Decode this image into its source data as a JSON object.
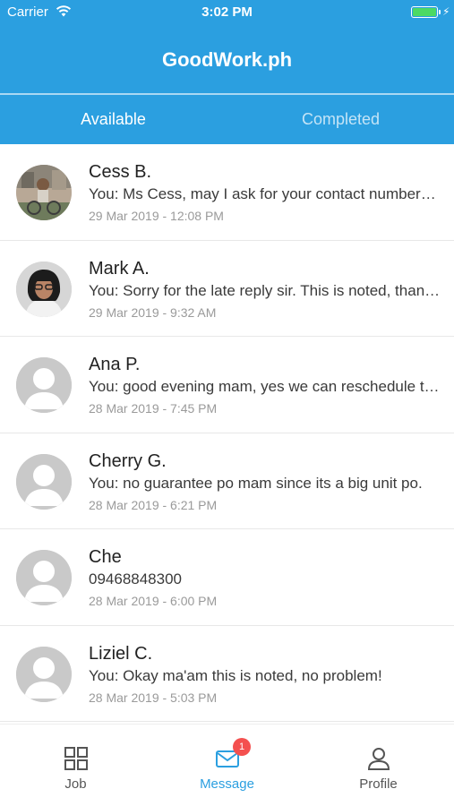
{
  "status_bar": {
    "carrier": "Carrier",
    "time": "3:02 PM"
  },
  "header": {
    "title": "GoodWork.ph"
  },
  "tabs": [
    {
      "label": "Available",
      "active": true
    },
    {
      "label": "Completed",
      "active": false
    }
  ],
  "conversations": [
    {
      "name": "Cess  B.",
      "message": "You: Ms Cess, may I ask for your contact number please?",
      "date": "29 Mar 2019 - 12:08 PM",
      "avatar": "photo"
    },
    {
      "name": "Mark  A.",
      "message": "You: Sorry for the late reply sir. This is noted, thank you.",
      "date": "29 Mar 2019 - 9:32 AM",
      "avatar": "photo"
    },
    {
      "name": "Ana  P.",
      "message": "You: good evening mam, yes we can reschedule tomorrow.",
      "date": "28 Mar 2019 - 7:45 PM",
      "avatar": "placeholder"
    },
    {
      "name": "Cherry  G.",
      "message": "You: no guarantee po mam since its a big unit po.",
      "date": "28 Mar 2019 - 6:21 PM",
      "avatar": "placeholder"
    },
    {
      "name": "Che",
      "message": "09468848300",
      "date": "28 Mar 2019 - 6:00 PM",
      "avatar": "placeholder"
    },
    {
      "name": "Liziel  C.",
      "message": "You: Okay ma'am this is noted, no problem!",
      "date": "28 Mar 2019 - 5:03 PM",
      "avatar": "placeholder"
    }
  ],
  "bottom_nav": {
    "items": [
      {
        "label": "Job",
        "icon": "grid-icon"
      },
      {
        "label": "Message",
        "icon": "envelope-icon",
        "badge": "1",
        "active": true
      },
      {
        "label": "Profile",
        "icon": "person-icon"
      }
    ]
  },
  "colors": {
    "primary": "#2b9fe0",
    "badge": "#f4504f",
    "battery": "#4cd964"
  }
}
